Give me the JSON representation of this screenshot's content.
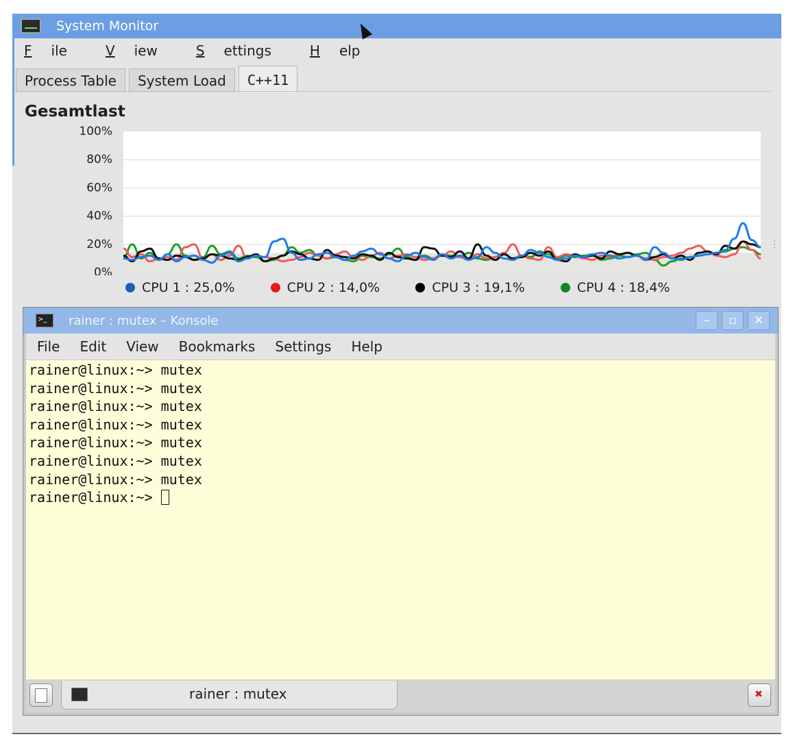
{
  "system_monitor": {
    "title": "System Monitor",
    "menu": [
      {
        "label": "File",
        "accel": "F",
        "rest": "ile"
      },
      {
        "label": "View",
        "accel": "V",
        "rest": "iew"
      },
      {
        "label": "Settings",
        "accel": "S",
        "rest": "ettings"
      },
      {
        "label": "Help",
        "accel": "H",
        "rest": "elp"
      }
    ],
    "tabs": [
      "Process Table",
      "System Load",
      "C++11"
    ],
    "active_tab": 2,
    "chart_title": "Gesamtlast"
  },
  "chart_data": {
    "type": "line",
    "title": "Gesamtlast",
    "ylim": [
      0,
      100
    ],
    "yticks": [
      "100%",
      "80%",
      "60%",
      "40%",
      "20%",
      "0%"
    ],
    "grid": true,
    "legend_placement": "bottom",
    "series": [
      {
        "name": "CPU 1 : 25,0%",
        "color": "#1e7be8",
        "values": [
          10,
          9,
          11,
          12,
          9,
          13,
          8,
          11,
          12,
          9,
          7,
          12,
          14,
          8,
          10,
          12,
          11,
          22,
          24,
          14,
          9,
          10,
          13,
          14,
          11,
          9,
          12,
          15,
          17,
          13,
          10,
          8,
          12,
          14,
          11,
          9,
          13,
          10,
          12,
          9,
          11,
          18,
          14,
          10,
          9,
          12,
          16,
          14,
          11,
          9,
          10,
          12,
          11,
          13,
          14,
          12,
          10,
          11,
          12,
          9,
          18,
          14,
          10,
          9,
          11,
          12,
          13,
          14,
          16,
          24,
          35,
          23,
          18
        ]
      },
      {
        "name": "CPU 2 : 14,0%",
        "color": "#f05a5a",
        "values": [
          17,
          11,
          13,
          8,
          10,
          11,
          9,
          18,
          20,
          10,
          13,
          9,
          12,
          19,
          10,
          12,
          11,
          10,
          8,
          9,
          11,
          14,
          12,
          10,
          13,
          15,
          11,
          9,
          12,
          14,
          10,
          12,
          13,
          11,
          9,
          10,
          12,
          15,
          11,
          9,
          13,
          10,
          11,
          14,
          20,
          12,
          10,
          9,
          18,
          11,
          13,
          12,
          10,
          9,
          12,
          11,
          13,
          14,
          12,
          10,
          9,
          11,
          12,
          14,
          17,
          19,
          15,
          12,
          11,
          13,
          22,
          16,
          10
        ]
      },
      {
        "name": "CPU 3 : 19,1%",
        "color": "#111111",
        "values": [
          12,
          8,
          15,
          17,
          10,
          9,
          12,
          11,
          9,
          10,
          13,
          12,
          10,
          9,
          11,
          13,
          8,
          10,
          12,
          15,
          13,
          10,
          9,
          16,
          12,
          11,
          10,
          13,
          12,
          9,
          14,
          11,
          10,
          9,
          18,
          17,
          12,
          11,
          15,
          10,
          20,
          12,
          9,
          13,
          10,
          11,
          14,
          12,
          15,
          9,
          8,
          13,
          11,
          12,
          10,
          15,
          13,
          14,
          12,
          9,
          11,
          13,
          10,
          12,
          9,
          14,
          15,
          13,
          19,
          17,
          22,
          20,
          18
        ]
      },
      {
        "name": "CPU 4 : 18,4%",
        "color": "#1e9d2a",
        "values": [
          11,
          20,
          10,
          14,
          9,
          13,
          20,
          12,
          9,
          11,
          19,
          13,
          15,
          10,
          12,
          11,
          8,
          9,
          12,
          18,
          14,
          16,
          12,
          10,
          11,
          9,
          8,
          12,
          11,
          10,
          13,
          17,
          11,
          9,
          12,
          10,
          13,
          12,
          11,
          14,
          10,
          9,
          11,
          13,
          10,
          12,
          11,
          15,
          13,
          10,
          12,
          11,
          12,
          13,
          9,
          10,
          12,
          11,
          13,
          14,
          9,
          5,
          8,
          10,
          11,
          12,
          13,
          14,
          15,
          17,
          18,
          16,
          13
        ]
      }
    ]
  },
  "konsole": {
    "title": "rainer : mutex – Konsole",
    "menu": [
      "File",
      "Edit",
      "View",
      "Bookmarks",
      "Settings",
      "Help"
    ],
    "prompt": "rainer@linux:~> ",
    "lines": [
      "rainer@linux:~> mutex",
      "rainer@linux:~> mutex",
      "rainer@linux:~> mutex",
      "rainer@linux:~> mutex",
      "rainer@linux:~> mutex",
      "rainer@linux:~> mutex",
      "rainer@linux:~> mutex"
    ],
    "tab_label": "rainer : mutex"
  }
}
